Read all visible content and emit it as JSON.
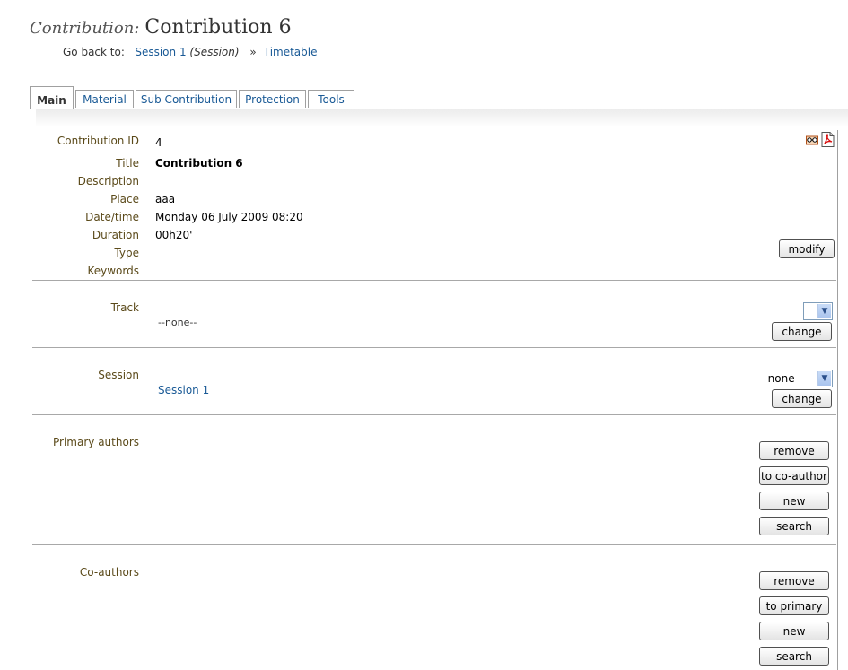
{
  "header": {
    "prefix": "Contribution:",
    "title": "Contribution 6",
    "go_back_label": "Go back to:",
    "session_link": "Session 1",
    "session_type": "(Session)",
    "separator": "»",
    "timetable_link": "Timetable"
  },
  "tabs": [
    {
      "label": "Main",
      "active": true
    },
    {
      "label": "Material",
      "active": false
    },
    {
      "label": "Sub Contribution",
      "active": false
    },
    {
      "label": "Protection",
      "active": false
    },
    {
      "label": "Tools",
      "active": false
    }
  ],
  "icons": {
    "first": "glasses-icon",
    "second": "pdf-icon"
  },
  "details": {
    "labels": {
      "id": "Contribution ID",
      "title": "Title",
      "description": "Description",
      "place": "Place",
      "datetime": "Date/time",
      "duration": "Duration",
      "type": "Type",
      "keywords": "Keywords"
    },
    "values": {
      "id": "4",
      "title": "Contribution 6",
      "description": "",
      "place": "aaa",
      "datetime": "Monday 06 July 2009 08:20",
      "duration": "00h20'",
      "type": "",
      "keywords": ""
    },
    "modify_button": "modify"
  },
  "track": {
    "label": "Track",
    "value": "--none--",
    "select_value": "",
    "change_button": "change"
  },
  "session": {
    "label": "Session",
    "value": "Session 1",
    "select_value": "--none--",
    "change_button": "change"
  },
  "primary_authors": {
    "label": "Primary authors",
    "buttons": {
      "remove": "remove",
      "to_other": "to co-author",
      "new": "new",
      "search": "search"
    }
  },
  "co_authors": {
    "label": "Co-authors",
    "buttons": {
      "remove": "remove",
      "to_other": "to primary",
      "new": "new",
      "search": "search"
    }
  }
}
